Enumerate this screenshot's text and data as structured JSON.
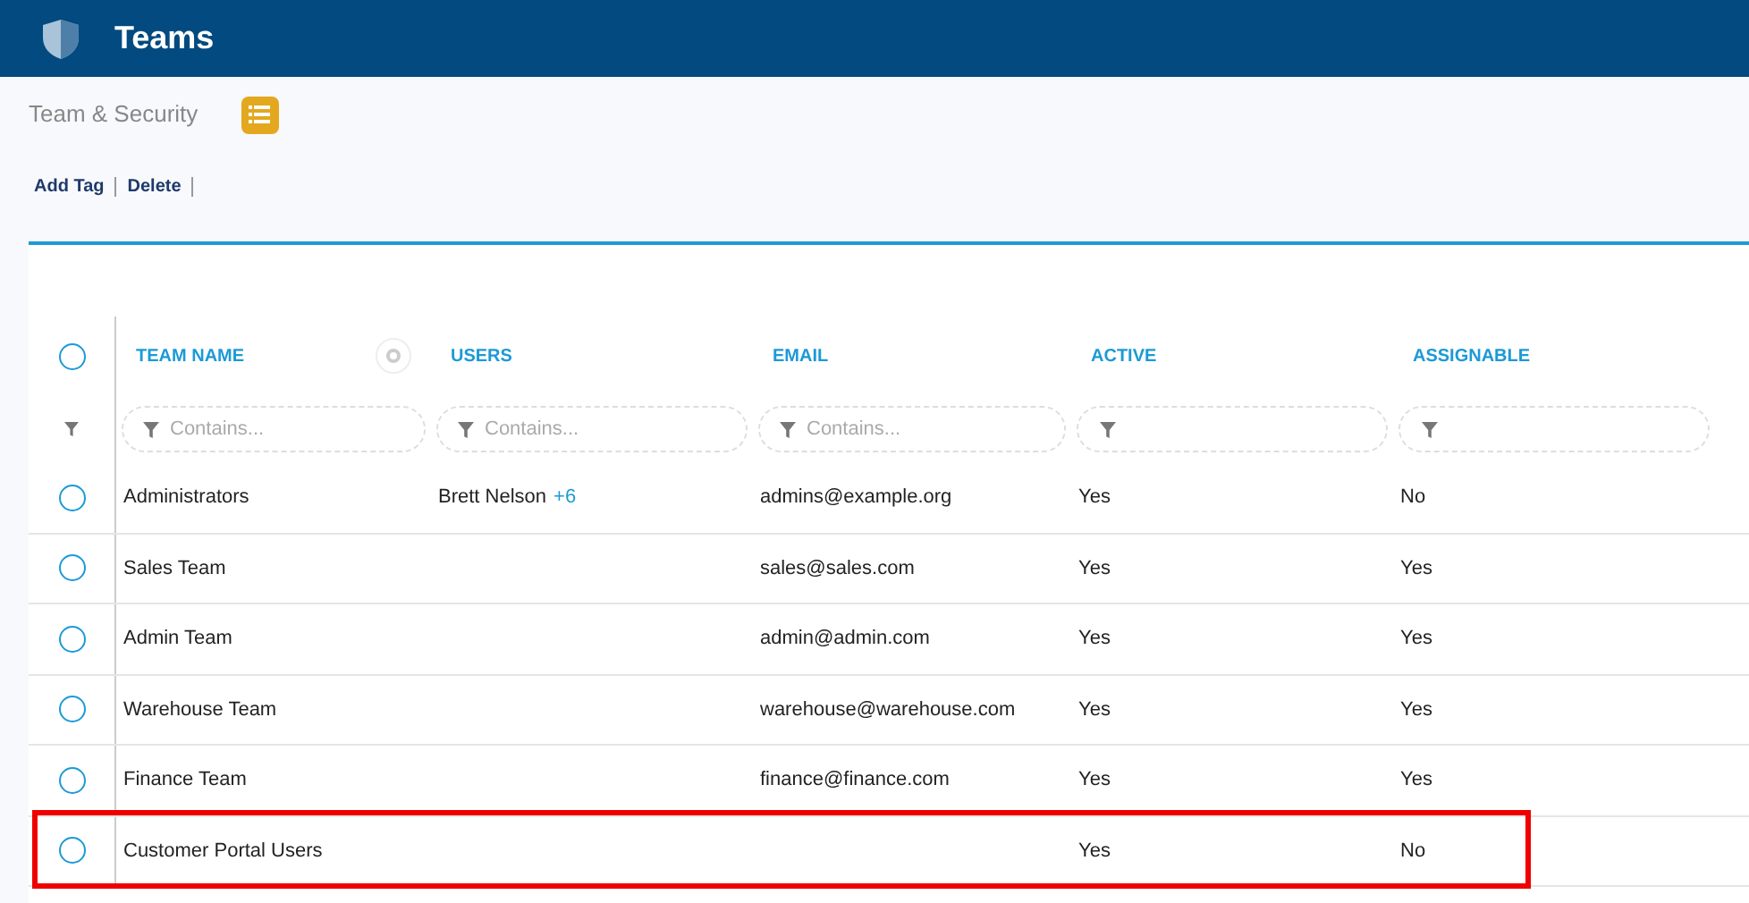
{
  "header": {
    "title": "Teams"
  },
  "breadcrumb": {
    "label": "Team & Security"
  },
  "toolbar": [
    "Add Tag",
    "Delete"
  ],
  "table": {
    "columns": [
      "TEAM NAME",
      "USERS",
      "EMAIL",
      "ACTIVE",
      "ASSIGNABLE"
    ],
    "all_selected": false,
    "filters": [
      {
        "kind": "text",
        "placeholder": "Contains..."
      },
      {
        "kind": "text",
        "placeholder": "Contains..."
      },
      {
        "kind": "text",
        "placeholder": "Contains..."
      },
      {
        "kind": "icon"
      },
      {
        "kind": "icon"
      }
    ],
    "rows": [
      {
        "selected": false,
        "highlighted": false,
        "cells": [
          "Administrators",
          "Brett Nelson",
          "admins@example.org",
          "Yes",
          "No"
        ],
        "extra": "+6"
      },
      {
        "selected": false,
        "highlighted": false,
        "cells": [
          "Sales Team",
          "",
          "sales@sales.com",
          "Yes",
          "Yes"
        ]
      },
      {
        "selected": false,
        "highlighted": false,
        "cells": [
          "Admin Team",
          "",
          "admin@admin.com",
          "Yes",
          "Yes"
        ]
      },
      {
        "selected": false,
        "highlighted": false,
        "cells": [
          "Warehouse Team",
          "",
          "warehouse@warehouse.com",
          "Yes",
          "Yes"
        ]
      },
      {
        "selected": false,
        "highlighted": false,
        "cells": [
          "Finance Team",
          "",
          "finance@finance.com",
          "Yes",
          "Yes"
        ]
      },
      {
        "selected": false,
        "highlighted": true,
        "cells": [
          "Customer Portal Users",
          "",
          "",
          "Yes",
          "No"
        ]
      }
    ]
  }
}
